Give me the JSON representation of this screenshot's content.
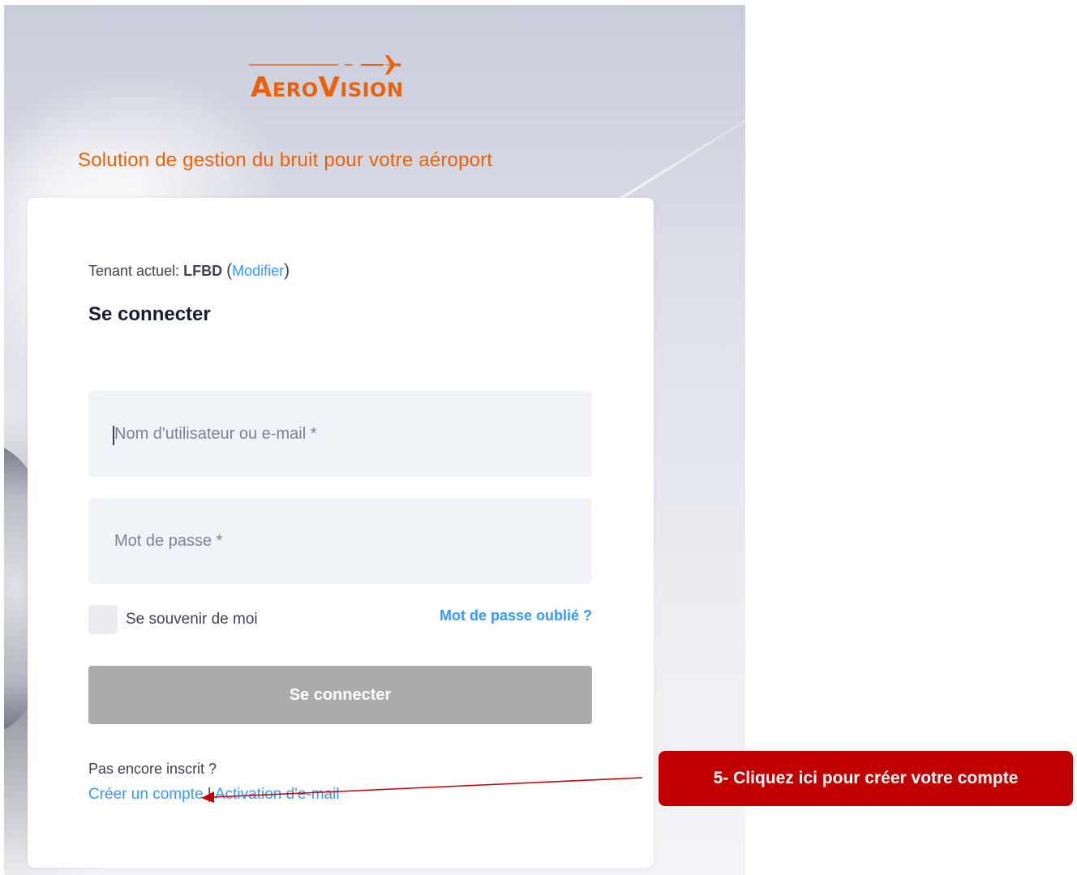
{
  "brand": {
    "logo_text": "AeroVision",
    "tagline": "Solution de gestion du bruit pour votre aéroport",
    "accent_color": "#e8620c"
  },
  "login": {
    "tenant_label": "Tenant actuel:",
    "tenant_value": "LFBD",
    "tenant_open_paren": "(",
    "tenant_change_link": "Modifier",
    "tenant_close_paren": ")",
    "heading": "Se connecter",
    "username_placeholder": "Nom d'utilisateur ou e-mail *",
    "password_placeholder": "Mot de passe *",
    "remember_label": "Se souvenir de moi",
    "remember_checked": false,
    "forgot_link": "Mot de passe oublié ?",
    "submit_label": "Se connecter",
    "not_registered_text": "Pas encore inscrit ?",
    "create_account_link": "Créer un compte",
    "separator": "|",
    "email_activation_link": "Activation d'e-mail"
  },
  "annotation": {
    "callout_text": "5- Cliquez ici pour créer votre compte",
    "color": "#c00000"
  }
}
